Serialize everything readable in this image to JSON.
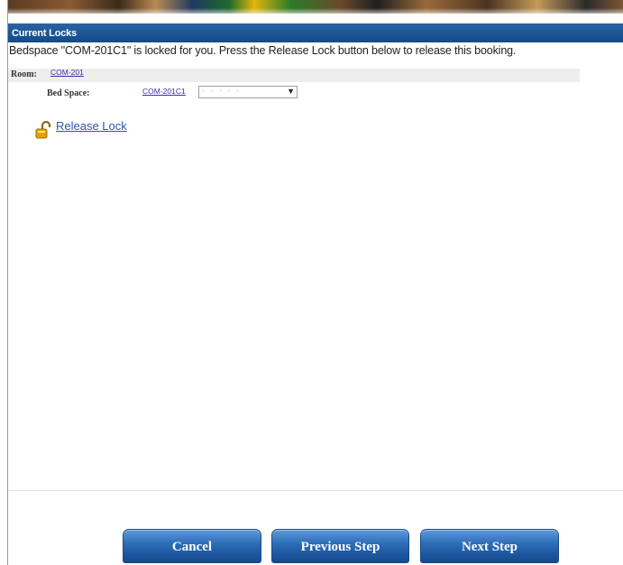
{
  "locks": {
    "header": "Current Locks",
    "message": "Bedspace \"COM-201C1\" is locked for you. Press the Release Lock button below to release this booking.",
    "room": {
      "label": "Room:",
      "link": "COM-201"
    },
    "bed_space": {
      "label": "Bed Space:",
      "link": "COM-201C1",
      "select_value": "· · · · ·",
      "arrow": "▼"
    },
    "release_label": "Release Lock",
    "release_icon": "unlocked-padlock-icon",
    "padlock_color": "#e0a400"
  },
  "buttons": {
    "cancel": "Cancel",
    "previous": "Previous Step",
    "next": "Next Step"
  },
  "colors": {
    "header_blue": "#1d56a0",
    "link_blue": "#2d55b0",
    "button_blue": "#2e6fb9"
  }
}
